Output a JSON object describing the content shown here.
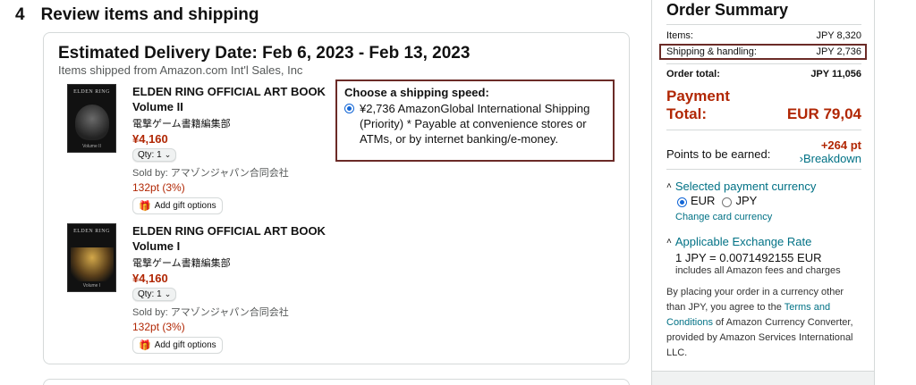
{
  "step": {
    "number": "4",
    "title": "Review items and shipping"
  },
  "delivery": {
    "title": "Estimated Delivery Date: Feb 6, 2023 - Feb 13, 2023",
    "shipped_from": "Items shipped from Amazon.com Int'l Sales, Inc"
  },
  "items": [
    {
      "cover_text": "ELDEN RING",
      "cover_vol": "Volume II",
      "title_line1": "ELDEN RING OFFICIAL ART BOOK",
      "title_line2": "Volume II",
      "author": "電撃ゲーム書籍編集部",
      "price": "¥4,160",
      "qty_label": "Qty: 1",
      "sold_by": "Sold by: アマゾンジャパン合同会社",
      "points": "132pt (3%)",
      "gift_label": "Add gift options"
    },
    {
      "cover_text": "ELDEN RING",
      "cover_vol": "Volume I",
      "title_line1": "ELDEN RING OFFICIAL ART BOOK",
      "title_line2": "Volume I",
      "author": "電撃ゲーム書籍編集部",
      "price": "¥4,160",
      "qty_label": "Qty: 1",
      "sold_by": "Sold by: アマゾンジャパン合同会社",
      "points": "132pt (3%)",
      "gift_label": "Add gift options"
    }
  ],
  "shipping_speed": {
    "title": "Choose a shipping speed:",
    "option_text": "¥2,736 AmazonGlobal International Shipping (Priority) * Payable at convenience stores or ATMs, or by internet banking/e-money.",
    "selected": true
  },
  "summary": {
    "title": "Order Summary",
    "items_label": "Items:",
    "items_value": "JPY 8,320",
    "shipping_label": "Shipping & handling:",
    "shipping_value": "JPY 2,736",
    "total_label": "Order total:",
    "total_value": "JPY 11,056",
    "payment_label_1": "Payment",
    "payment_label_2": "Total:",
    "payment_value": "EUR 79,04",
    "points_label": "Points to be earned:",
    "points_value": "+264 pt",
    "breakdown_label": "›Breakdown",
    "currency_section": "Selected payment currency",
    "currency_options": [
      "EUR",
      "JPY"
    ],
    "currency_selected": "EUR",
    "change_card": "Change card currency",
    "exchange_section": "Applicable Exchange Rate",
    "exchange_rate": "1 JPY = 0.0071492155 EUR",
    "exchange_note": "includes all Amazon fees and charges",
    "disclaimer_1": "By placing your order in a currency other than JPY, you agree to the ",
    "disclaimer_link": "Terms and Conditions",
    "disclaimer_2": " of Amazon Currency Converter, provided by Amazon Services International LLC."
  },
  "colors": {
    "price_red": "#b12704",
    "link_teal": "#007185",
    "highlight_border": "#6b2b27",
    "radio_blue": "#1266d6"
  }
}
